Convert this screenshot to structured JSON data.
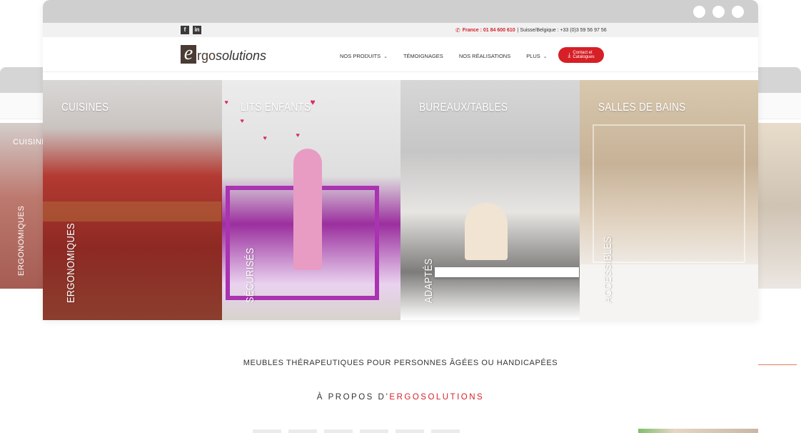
{
  "bg_window": {
    "left_label": "CUISINES",
    "left_vertical": "ERGONOMIQUES"
  },
  "topbar": {
    "social": [
      "f",
      "in"
    ],
    "phone_france": "France : 01 84 600 610",
    "phone_other": "| Suisse/Belgique : +33 (0)3 59 56 97 56"
  },
  "logo": {
    "e": "e",
    "ergo": "rgo",
    "solutions": "solutions"
  },
  "nav": {
    "items": [
      {
        "label": "NOS PRODUITS",
        "dropdown": true
      },
      {
        "label": "TÉMOIGNAGES",
        "dropdown": false
      },
      {
        "label": "NOS RÉALISATIONS",
        "dropdown": false
      },
      {
        "label": "PLUS",
        "dropdown": true
      }
    ],
    "cta_line1": "Contact et",
    "cta_line2": "Catalogues"
  },
  "panels": [
    {
      "title": "CUISINES",
      "vertical": "ERGONOMIQUES"
    },
    {
      "title": "LITS ENFANTS",
      "vertical": "SÉCURISÉS"
    },
    {
      "title": "BUREAUX/TABLES",
      "vertical": "ADAPTÉS"
    },
    {
      "title": "SALLES DE BAINS",
      "vertical": "ACCESSIBLES"
    }
  ],
  "tagline": "MEUBLES THÉRAPEUTIQUES POUR PERSONNES ÂGÉES OU HANDICAPÉES",
  "about": {
    "prefix": "À PROPOS D’",
    "brand": "ERGOSOLUTIONS"
  },
  "colors": {
    "accent": "#d61f26",
    "chrome": "#cfcfcf"
  }
}
